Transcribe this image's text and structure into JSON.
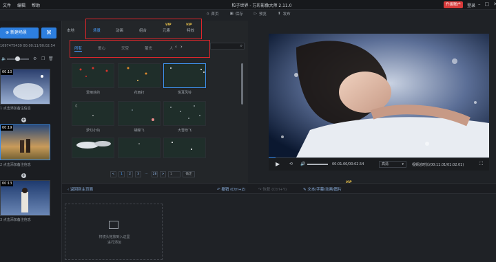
{
  "titlebar": {
    "menu": [
      "文件",
      "编辑",
      "帮助"
    ],
    "title": "粒子世界 - 万彩影像大师 2.11.0",
    "upgrade_label": "升级账户",
    "login_label": "登录"
  },
  "toolbar": {
    "items": [
      {
        "label": "首页",
        "icon": "home-icon"
      },
      {
        "label": "保存",
        "icon": "save-icon"
      },
      {
        "label": "预览",
        "icon": "preview-icon"
      },
      {
        "label": "发布",
        "icon": "upload-icon"
      }
    ]
  },
  "left": {
    "new_scene_label": "新建场景",
    "timecode": "1697475439   00:00:11/00:02:54",
    "scenes": [
      {
        "num": "1",
        "time": "00:10",
        "caption": "点击添加备注信息"
      },
      {
        "num": "2",
        "time": "00:19",
        "caption": "点击添加备注信息"
      },
      {
        "num": "3",
        "time": "00:13",
        "caption": "点击添加备注信息"
      }
    ]
  },
  "library": {
    "local_tab": "本地",
    "category_tabs": [
      "场景",
      "动画",
      "组合",
      "元素",
      "特效"
    ],
    "active_category": "场景",
    "vip_label": "VIP",
    "filter_tabs": [
      "所有",
      "爱心",
      "天空",
      "萤光",
      "人"
    ],
    "active_filter": "所有",
    "tiles": [
      {
        "caption": "爱丽丝的",
        "selected": false
      },
      {
        "caption": "花雨打",
        "selected": false
      },
      {
        "caption": "悦耳风铃",
        "selected": true
      },
      {
        "caption": "梦幻小仙",
        "selected": false
      },
      {
        "caption": "蝴蝶飞",
        "selected": false
      },
      {
        "caption": "大雪纷飞",
        "selected": false
      },
      {
        "caption": "",
        "selected": false
      },
      {
        "caption": "",
        "selected": false
      },
      {
        "caption": "",
        "selected": false
      }
    ],
    "pager": {
      "pages": [
        "<",
        "1",
        "2",
        "3",
        "...",
        "28",
        ">"
      ],
      "current": "1",
      "goto_value": "1",
      "confirm_label": "确定"
    }
  },
  "preview": {
    "time_display": "00:01.00/00:02.54",
    "clarity": "高清",
    "scene_time": "视频总时长(00:11.01/01:02.01)",
    "progress_fraction": 0.03
  },
  "editbar": {
    "back_label": "返回到主页面",
    "undo_label": "撤销 (Ctrl+Z)",
    "redo_label": "恢复 (Ctrl+Y)",
    "text_label": "文本/字幕/动画/图片",
    "vip_label": "VIP"
  },
  "dropzone": {
    "line1": "将镜头拖放到入这里",
    "line2": "进行添加"
  },
  "colors": {
    "accent": "#3e8eea",
    "upgrade": "#d83a3a",
    "highlight": "#e0262b",
    "vip": "#f2c94c"
  }
}
